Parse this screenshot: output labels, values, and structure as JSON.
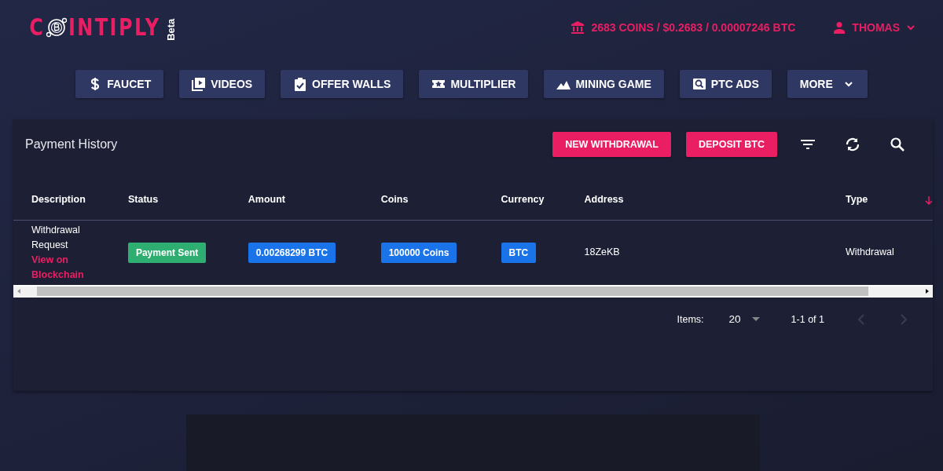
{
  "logo": {
    "first_letter": "C",
    "rest": "INTIPLY",
    "tag": "Beta"
  },
  "balance": "2683 COINS / $0.2683 / 0.00007246 BTC",
  "user": {
    "name": "THOMAS"
  },
  "nav": [
    {
      "kind": "link",
      "label": "FAUCET"
    },
    {
      "kind": "link",
      "label": "VIDEOS"
    },
    {
      "kind": "link",
      "label": "OFFER WALLS"
    },
    {
      "kind": "link",
      "label": "MULTIPLIER"
    },
    {
      "kind": "link",
      "label": "MINING GAME"
    },
    {
      "kind": "link",
      "label": "PTC ADS"
    },
    {
      "kind": "menu",
      "label": "MORE"
    }
  ],
  "panel": {
    "title": "Payment History",
    "actions": [
      "NEW WITHDRAWAL",
      "DEPOSIT BTC"
    ],
    "table": {
      "columns": [
        "Description",
        "Status",
        "Amount",
        "Coins",
        "Currency",
        "Address",
        "Type"
      ],
      "rows": [
        {
          "description": "Withdrawal Request",
          "link": "View on Blockchain",
          "status": {
            "text": "Payment Sent",
            "color": "#2eaf71"
          },
          "amount": {
            "text": "0.00268299 BTC",
            "color": "#1a73e8"
          },
          "coins": {
            "text": "100000 Coins",
            "color": "#1a73e8"
          },
          "currency": {
            "text": "BTC",
            "color": "#1a73e8"
          },
          "address": "18ZeKB",
          "type": "Withdrawal"
        }
      ]
    },
    "pager": {
      "label": "Items:",
      "size": "20",
      "range": "1-1 of 1",
      "prev_disabled": true,
      "next_disabled": true
    }
  }
}
